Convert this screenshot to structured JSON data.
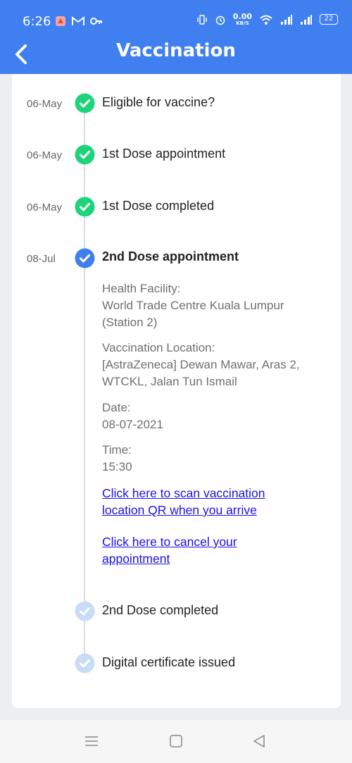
{
  "status_bar": {
    "time": "6:26",
    "net_speed_value": "0.00",
    "net_speed_unit": "KB/S",
    "battery": "22"
  },
  "header": {
    "title": "Vaccination",
    "color": "#3f7ff0"
  },
  "timeline": [
    {
      "date": "06-May",
      "title": "Eligible for vaccine?",
      "status": "done"
    },
    {
      "date": "06-May",
      "title": "1st Dose appointment",
      "status": "done"
    },
    {
      "date": "06-May",
      "title": "1st Dose completed",
      "status": "done"
    },
    {
      "date": "08-Jul",
      "title": "2nd Dose appointment",
      "status": "current"
    },
    {
      "date": "",
      "title": "2nd Dose completed",
      "status": "pending"
    },
    {
      "date": "",
      "title": "Digital certificate issued",
      "status": "pending"
    }
  ],
  "appointment": {
    "facility_label": "Health Facility:",
    "facility_value": "World Trade Centre Kuala Lumpur (Station 2)",
    "location_label": "Vaccination Location:",
    "location_value": "[AstraZeneca] Dewan Mawar, Aras 2, WTCKL, Jalan Tun Ismail",
    "date_label": "Date:",
    "date_value": "08-07-2021",
    "time_label": "Time:",
    "time_value": "15:30",
    "scan_link": "Click here to scan vaccination location QR when you arrive",
    "cancel_link": "Click here to cancel your appointment"
  },
  "colors": {
    "done": "#1ed47a",
    "current": "#3f7ff0",
    "pending": "#c9dcf7",
    "link": "#1a12e8"
  }
}
